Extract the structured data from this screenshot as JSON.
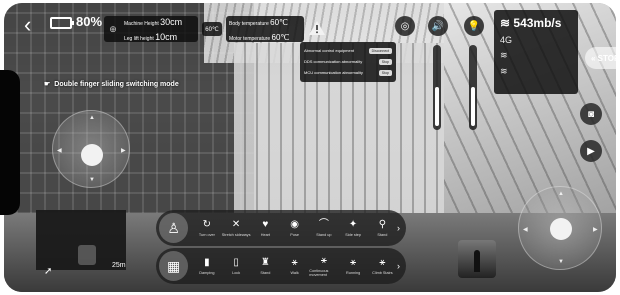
{
  "status": {
    "battery_pct": "80%",
    "machine_height_label": "Machine Height",
    "machine_height_value": "30cm",
    "leg_lift_label": "Leg lift height",
    "leg_lift_value": "10cm",
    "temp_badge": "60℃",
    "body_temp_label": "Body temperature",
    "body_temp_value": "60℃",
    "motor_temp_label": "Motor temperature",
    "motor_temp_value": "60℃"
  },
  "alarms": [
    {
      "label": "Abnormal control equipment",
      "state": "Disconnect"
    },
    {
      "label": "DDS communication abnormality",
      "state": "Stop"
    },
    {
      "label": "MCU communication abnormality",
      "state": "Stop"
    }
  ],
  "network": {
    "speed": "543mb/s",
    "cell_label": "4G"
  },
  "stop_label": "« STOP",
  "hint": "Double finger sliding switching mode",
  "map_scale": "25m",
  "action_modes": [
    {
      "icon": "↻",
      "label": "Turn over"
    },
    {
      "icon": "✕",
      "label": "Stretch sideways"
    },
    {
      "icon": "♥",
      "label": "Heart"
    },
    {
      "icon": "◉",
      "label": "Pose"
    },
    {
      "icon": "⌒",
      "label": "Stand up"
    },
    {
      "icon": "✦",
      "label": "Side step"
    },
    {
      "icon": "⚲",
      "label": "Stand"
    }
  ],
  "gait_modes": [
    {
      "icon": "▮",
      "label": "Damping"
    },
    {
      "icon": "▯",
      "label": "Lock"
    },
    {
      "icon": "♜",
      "label": "Stand"
    },
    {
      "icon": "⚹",
      "label": "Walk"
    },
    {
      "icon": "⚹",
      "label": "Continuous movement"
    },
    {
      "icon": "⚹",
      "label": "Running"
    },
    {
      "icon": "⚹",
      "label": "Climb Stairs"
    }
  ],
  "sliders": {
    "left_level": 0.5,
    "right_level": 0.5
  },
  "colors": {
    "panel": "#0f0f0f",
    "accent": "#ffffff"
  }
}
